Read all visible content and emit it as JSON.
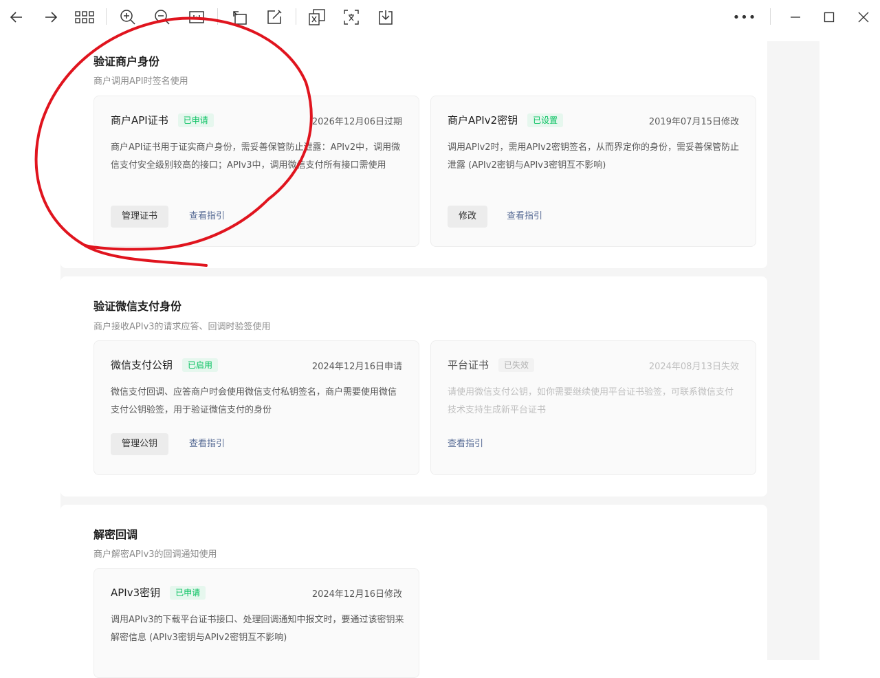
{
  "toolbar": {
    "buttons": [
      {
        "name": "back-button",
        "icon": "arrow-left-icon"
      },
      {
        "name": "forward-button",
        "icon": "arrow-right-icon"
      },
      {
        "name": "grid-view-button",
        "icon": "grid-icon"
      },
      {
        "name": "zoom-in-button",
        "icon": "zoom-in-icon"
      },
      {
        "name": "zoom-out-button",
        "icon": "zoom-out-icon"
      },
      {
        "name": "actual-size-button",
        "icon": "actual-size-icon"
      },
      {
        "name": "rotate-button",
        "icon": "rotate-icon"
      },
      {
        "name": "edit-button",
        "icon": "edit-icon"
      },
      {
        "name": "export-excel-button",
        "icon": "excel-icon"
      },
      {
        "name": "ocr-text-button",
        "icon": "text-recognize-icon"
      },
      {
        "name": "save-button",
        "icon": "download-icon"
      }
    ],
    "more_label": "•••",
    "window": {
      "minimize_icon": "minimize-icon",
      "maximize_icon": "maximize-icon",
      "close_icon": "close-icon"
    }
  },
  "sections": {
    "merchant_identity": {
      "title": "验证商户身份",
      "desc": "商户调用API时签名使用",
      "cards": {
        "api_cert": {
          "title": "商户API证书",
          "badge": "已申请",
          "date": "2026年12月06日过期",
          "desc": "商户API证书用于证实商户身份，需妥善保管防止泄露：APIv2中，调用微信支付安全级别较高的接口；APIv3中，调用微信支付所有接口需使用",
          "button": "管理证书",
          "link": "查看指引"
        },
        "apiv2_key": {
          "title": "商户APIv2密钥",
          "badge": "已设置",
          "date": "2019年07月15日修改",
          "desc": "调用APIv2时，需用APIv2密钥签名，从而界定你的身份，需妥善保管防止泄露 (APIv2密钥与APIv3密钥互不影响)",
          "button": "修改",
          "link": "查看指引"
        }
      }
    },
    "wechatpay_identity": {
      "title": "验证微信支付身份",
      "desc": "商户接收APIv3的请求应答、回调时验签使用",
      "cards": {
        "public_key": {
          "title": "微信支付公钥",
          "badge": "已启用",
          "date": "2024年12月16日申请",
          "desc": "微信支付回调、应答商户时会使用微信支付私钥签名，商户需要使用微信支付公钥验签，用于验证微信支付的身份",
          "button": "管理公钥",
          "link": "查看指引"
        },
        "platform_cert": {
          "title": "平台证书",
          "badge": "已失效",
          "date": "2024年08月13日失效",
          "desc": "请使用微信支付公钥，如你需要继续使用平台证书验签，可联系微信支付技术支持生成新平台证书",
          "link": "查看指引"
        }
      }
    },
    "decrypt_callback": {
      "title": "解密回调",
      "desc": "商户解密APIv3的回调通知使用",
      "cards": {
        "apiv3_key": {
          "title": "APIv3密钥",
          "badge": "已申请",
          "date": "2024年12月16日修改",
          "desc": "调用APIv3的下载平台证书接口、处理回调通知中报文时，要通过该密钥来解密信息 (APIv3密钥与APIv2密钥互不影响)"
        }
      }
    }
  },
  "colors": {
    "accent_green": "#07c160",
    "link_blue": "#576b95",
    "annotation_red": "#e0141e"
  }
}
